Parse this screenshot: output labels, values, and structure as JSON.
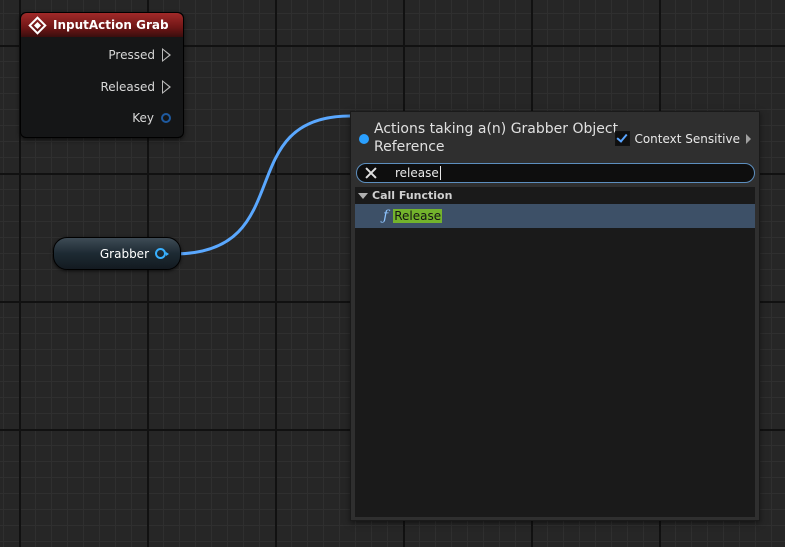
{
  "input_node": {
    "title": "InputAction Grab",
    "pins": {
      "pressed": "Pressed",
      "released": "Released",
      "key": "Key"
    }
  },
  "variable_node": {
    "label": "Grabber"
  },
  "action_menu": {
    "title": "Actions taking a(n) Grabber Object Reference",
    "context_sensitive_label": "Context Sensitive",
    "context_sensitive_checked": true,
    "search": {
      "value": "release"
    },
    "categories": [
      {
        "label": "Call Function",
        "items": [
          {
            "label": "Release",
            "icon": "function-icon",
            "selected": true
          }
        ]
      }
    ]
  },
  "colors": {
    "event_header": "#a12a29",
    "object_wire": "#5aa8ff",
    "selection": "#3d5067",
    "search_highlight": "#73b32c"
  }
}
